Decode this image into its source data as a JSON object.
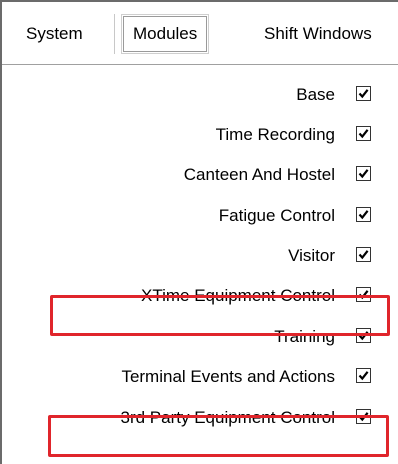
{
  "tabs": [
    {
      "label": "System",
      "selected": false
    },
    {
      "label": "Modules",
      "selected": true
    },
    {
      "label": "Shift Windows",
      "selected": false
    }
  ],
  "modules": [
    {
      "label": "Base",
      "checked": true
    },
    {
      "label": "Time Recording",
      "checked": true
    },
    {
      "label": "Canteen And Hostel",
      "checked": true
    },
    {
      "label": "Fatigue Control",
      "checked": true
    },
    {
      "label": "Visitor",
      "checked": true
    },
    {
      "label": "XTime Equipment Control",
      "checked": true,
      "highlighted": true
    },
    {
      "label": "Training",
      "checked": true
    },
    {
      "label": "Terminal Events and Actions",
      "checked": true
    },
    {
      "label": "3rd Party Equipment Control",
      "checked": true,
      "highlighted": true
    }
  ],
  "colors": {
    "highlight": "#e0252b",
    "checkmark": "#000000",
    "tab_border": "#9a9a9a"
  }
}
